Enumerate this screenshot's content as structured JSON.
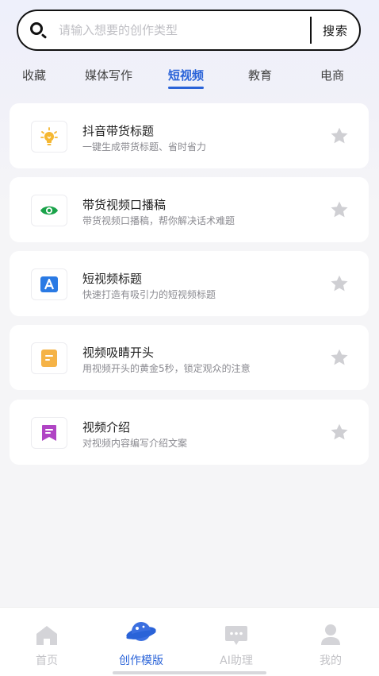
{
  "search": {
    "placeholder": "请输入想要的创作类型",
    "button_label": "搜索"
  },
  "tabs": [
    {
      "label": "收藏",
      "active": false
    },
    {
      "label": "媒体写作",
      "active": false
    },
    {
      "label": "短视频",
      "active": true
    },
    {
      "label": "教育",
      "active": false
    },
    {
      "label": "电商",
      "active": false
    }
  ],
  "templates": [
    {
      "title": "抖音带货标题",
      "subtitle": "一键生成带货标题、省时省力",
      "icon": "lightbulb-icon",
      "icon_color": "#f5b731"
    },
    {
      "title": "带货视频口播稿",
      "subtitle": "带货视频口播稿，帮你解决话术难题",
      "icon": "eye-icon",
      "icon_color": "#1aa34a"
    },
    {
      "title": "短视频标题",
      "subtitle": "快速打造有吸引力的短视频标题",
      "icon": "letter-a-icon",
      "icon_color": "#2a7ae4"
    },
    {
      "title": "视频吸睛开头",
      "subtitle": "用视频开头的黄金5秒，锁定观众的注意",
      "icon": "document-icon",
      "icon_color": "#f5b347"
    },
    {
      "title": "视频介绍",
      "subtitle": "对视频内容编写介绍文案",
      "icon": "bookmark-icon",
      "icon_color": "#b044c4"
    }
  ],
  "bottom_nav": [
    {
      "label": "首页",
      "icon": "home-icon",
      "active": false
    },
    {
      "label": "创作模版",
      "icon": "planet-icon",
      "active": true
    },
    {
      "label": "AI助理",
      "icon": "chat-icon",
      "active": false
    },
    {
      "label": "我的",
      "icon": "user-icon",
      "active": false
    }
  ],
  "colors": {
    "accent": "#2a63d8",
    "star_inactive": "#cfcfd3",
    "nav_inactive": "#c2c2c6"
  }
}
